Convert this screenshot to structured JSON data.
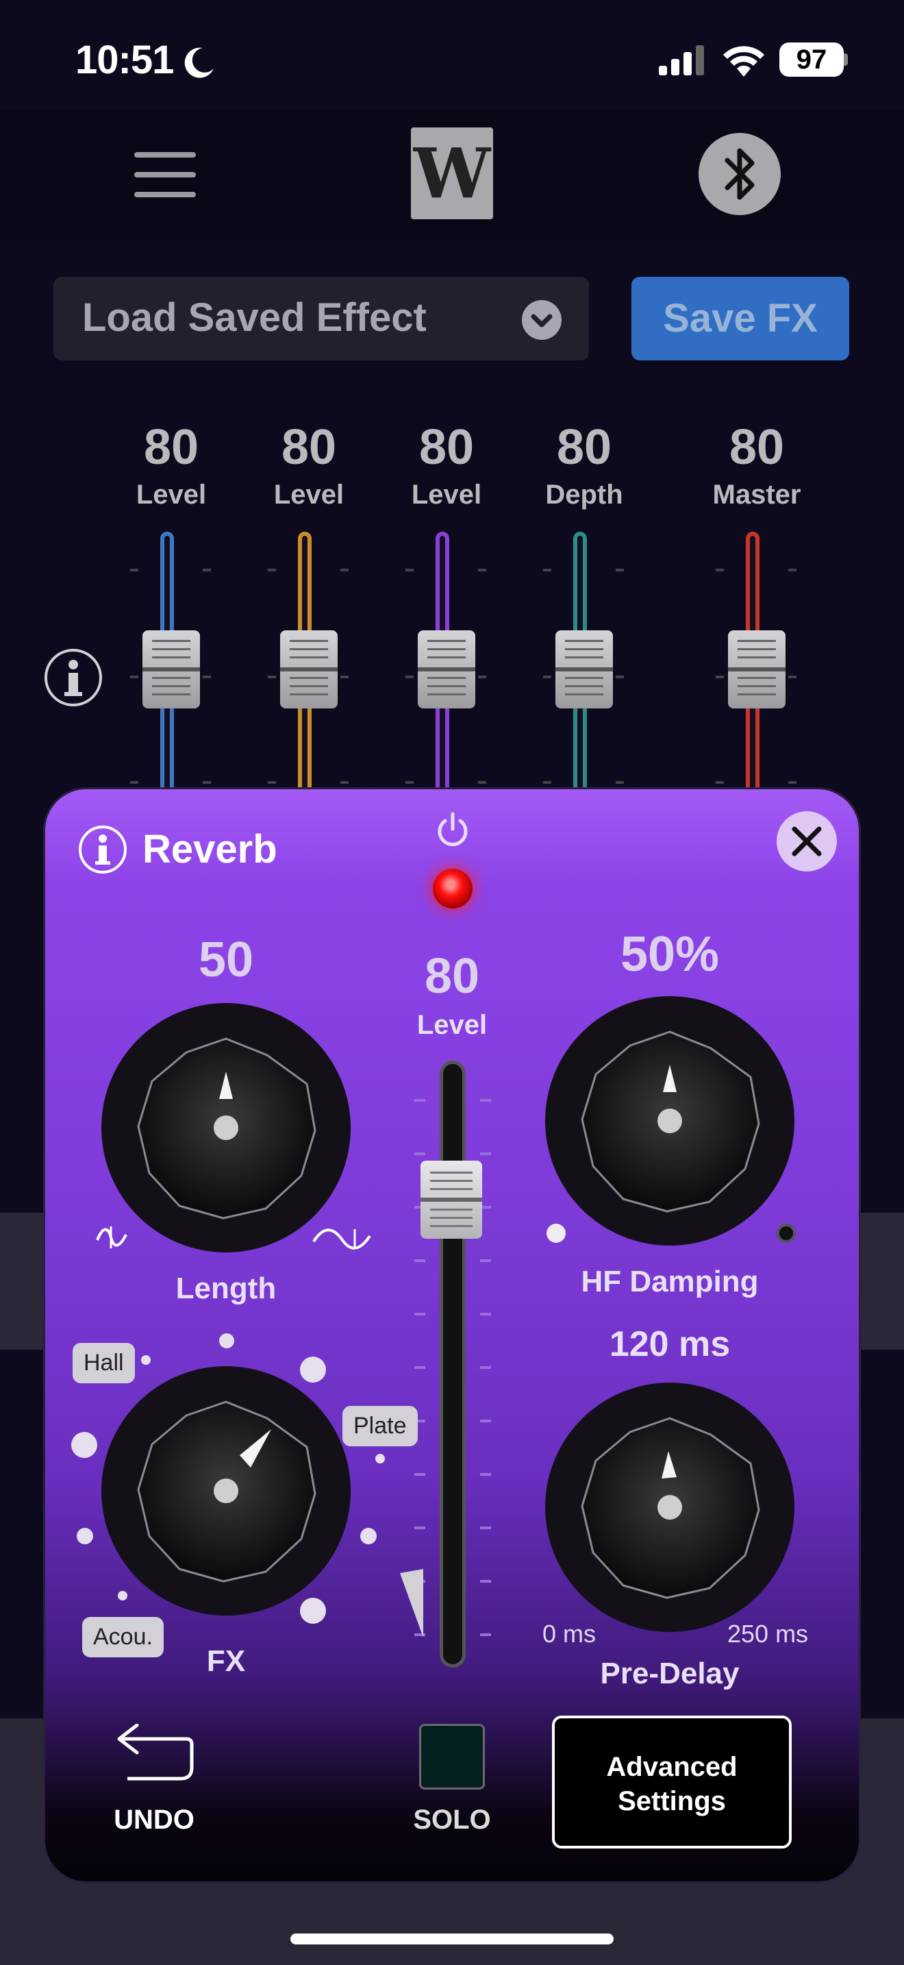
{
  "status_bar": {
    "time": "10:51",
    "battery": "97"
  },
  "header": {
    "logo_text": "W"
  },
  "presets": {
    "load_label": "Load Saved Effect",
    "save_label": "Save FX"
  },
  "mixer": {
    "channels": [
      {
        "value": "80",
        "label": "Level",
        "color": "#3f78c2"
      },
      {
        "value": "80",
        "label": "Level",
        "color": "#c7902a"
      },
      {
        "value": "80",
        "label": "Level",
        "color": "#8b3fd6"
      },
      {
        "value": "80",
        "label": "Depth",
        "color": "#2e8c86"
      },
      {
        "value": "80",
        "label": "Master",
        "color": "#c8362a"
      }
    ]
  },
  "reverb": {
    "title": "Reverb",
    "length": {
      "value": "50",
      "label": "Length"
    },
    "level": {
      "value": "80",
      "label": "Level"
    },
    "hf_damping": {
      "value": "50%",
      "label": "HF Damping"
    },
    "pre_delay": {
      "value": "120 ms",
      "label": "Pre-Delay",
      "min_label": "0 ms",
      "max_label": "250 ms"
    },
    "fx": {
      "label": "FX",
      "options": [
        "Hall",
        "Plate",
        "Acou."
      ]
    },
    "undo_label": "UNDO",
    "solo_label": "SOLO",
    "advanced_line1": "Advanced",
    "advanced_line2": "Settings"
  }
}
